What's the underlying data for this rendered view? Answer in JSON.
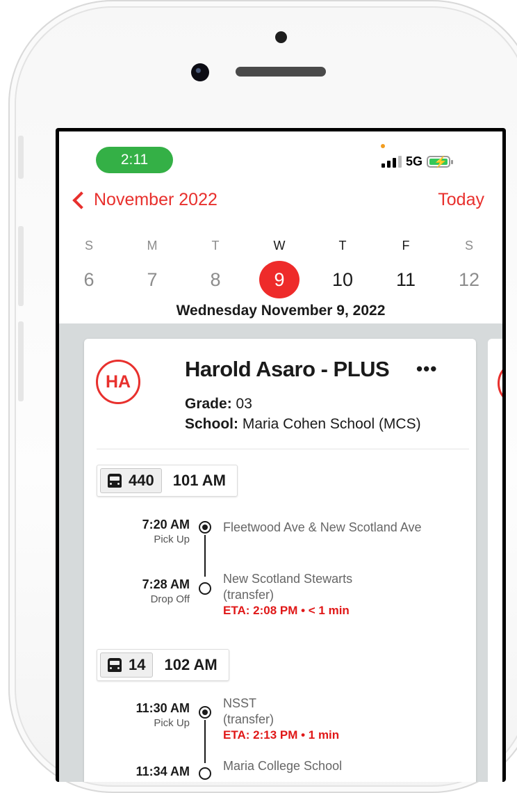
{
  "status_bar": {
    "time": "2:11",
    "network": "5G"
  },
  "header": {
    "month_label": "November 2022",
    "today_label": "Today"
  },
  "week": [
    {
      "dow": "S",
      "num": "6"
    },
    {
      "dow": "M",
      "num": "7"
    },
    {
      "dow": "T",
      "num": "8"
    },
    {
      "dow": "W",
      "num": "9"
    },
    {
      "dow": "T",
      "num": "10"
    },
    {
      "dow": "F",
      "num": "11"
    },
    {
      "dow": "S",
      "num": "12"
    }
  ],
  "selected_date_full": "Wednesday November 9, 2022",
  "student": {
    "initials": "HA",
    "name": "Harold Asaro - PLUS",
    "more_label": "•••",
    "grade_label": "Grade:",
    "grade_value": " 03",
    "school_label": "School:",
    "school_value": " Maria Cohen School (MCS)"
  },
  "trips": [
    {
      "bus": "440",
      "route": "101 AM",
      "stops": [
        {
          "time": "7:20 AM",
          "type": "Pick Up",
          "name": "Fleetwood Ave & New Scotland Ave"
        },
        {
          "time": "7:28 AM",
          "type": "Drop Off",
          "name": "New Scotland Stewarts",
          "name2": "(transfer)",
          "eta": "ETA: 2:08 PM • < 1 min"
        }
      ]
    },
    {
      "bus": "14",
      "route": "102 AM",
      "stops": [
        {
          "time": "11:30 AM",
          "type": "Pick Up",
          "name": "NSST",
          "name2": "(transfer)",
          "eta": "ETA: 2:13 PM • 1 min"
        },
        {
          "time": "11:34 AM",
          "name": "Maria College School"
        }
      ]
    }
  ],
  "colors": {
    "accent": "#e8302d",
    "status_green": "#34b046",
    "eta_red": "#e01818",
    "bg_gray": "#d6dadb"
  }
}
